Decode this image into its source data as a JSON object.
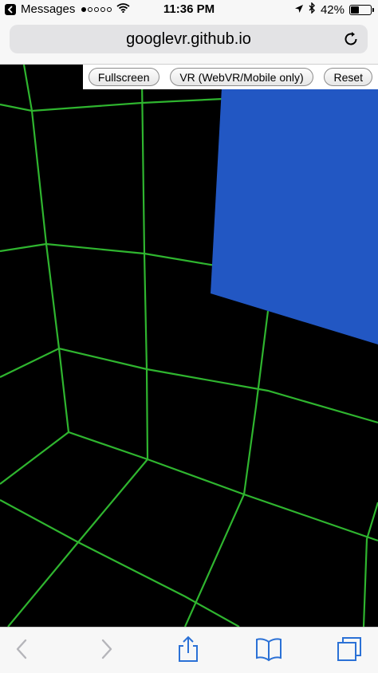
{
  "status_bar": {
    "back_app": "Messages",
    "time": "11:36 PM",
    "battery": "42%",
    "battery_level": 0.42,
    "signal_bars_filled": 1,
    "signal_bars_total": 5,
    "icons": [
      "back-arrow-icon",
      "wifi-icon",
      "location-arrow-icon",
      "bluetooth-icon",
      "battery-icon"
    ]
  },
  "browser": {
    "url": "googlevr.github.io",
    "icons": [
      "reload-icon"
    ]
  },
  "controls": {
    "fullscreen_label": "Fullscreen",
    "vr_label": "VR (WebVR/Mobile only)",
    "reset_label": "Reset"
  },
  "scene": {
    "background_color": "#000000",
    "grid_color": "#2fb52f",
    "cube_color": "#2257c3"
  },
  "toolbar": {
    "icons": [
      "back-icon",
      "forward-icon",
      "share-icon",
      "bookmarks-icon",
      "tabs-icon"
    ],
    "accent_color": "#2b71d6",
    "disabled_color": "#b5b5ba"
  }
}
